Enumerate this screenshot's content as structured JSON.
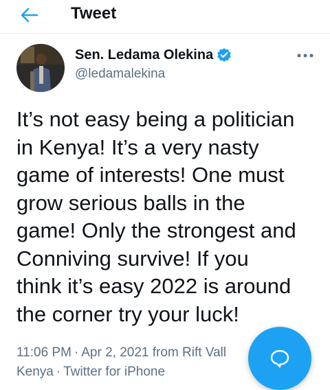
{
  "header": {
    "title": "Tweet",
    "back_icon": "arrow-left-icon"
  },
  "author": {
    "display_name": "Sen. Ledama Olekina",
    "handle": "@ledamalekina",
    "verified": true,
    "verified_icon": "verified-badge-icon"
  },
  "tweet": {
    "text": "It’s not easy being a politician\nin Kenya! It’s a very nasty\ngame of interests!  One must\ngrow serious balls in the\ngame! Only the strongest and\nConniving survive! If you\nthink it’s easy 2022 is around\nthe corner try your luck!",
    "time": "11:06 PM",
    "date": "Apr 2, 2021",
    "location": "from Rift Vall",
    "location_line2": "Kenya",
    "separator": "·",
    "source": "Twitter for iPhone"
  },
  "fab": {
    "icon": "reply-bubble-icon"
  },
  "colors": {
    "accent": "#1da1f2",
    "secondary_text": "#5b7083",
    "primary_text": "#0f1419"
  }
}
